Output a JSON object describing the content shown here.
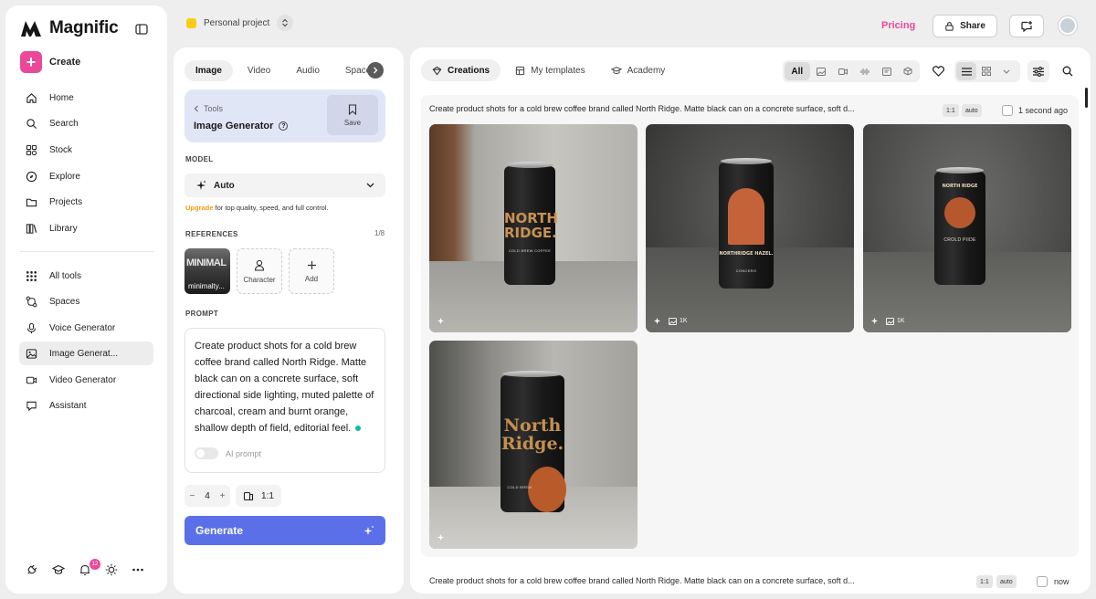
{
  "app": {
    "name": "Magnific"
  },
  "sidebar": {
    "create_label": "Create",
    "items": [
      {
        "label": "Home",
        "icon": "home-icon"
      },
      {
        "label": "Search",
        "icon": "search-icon"
      },
      {
        "label": "Stock",
        "icon": "stock-icon"
      },
      {
        "label": "Explore",
        "icon": "compass-icon"
      },
      {
        "label": "Projects",
        "icon": "folder-icon"
      },
      {
        "label": "Library",
        "icon": "library-icon"
      }
    ],
    "tools": [
      {
        "label": "All tools",
        "icon": "grid-icon"
      },
      {
        "label": "Spaces",
        "icon": "spaces-icon"
      },
      {
        "label": "Voice Generator",
        "icon": "mic-icon"
      },
      {
        "label": "Image Generat...",
        "icon": "image-icon",
        "active": true
      },
      {
        "label": "Video Generator",
        "icon": "video-icon"
      },
      {
        "label": "Assistant",
        "icon": "chat-icon"
      }
    ],
    "notification_count": "12"
  },
  "topbar": {
    "project_name": "Personal project",
    "project_color": "#facc15",
    "pricing_label": "Pricing",
    "share_label": "Share"
  },
  "tool_panel": {
    "tabs": [
      "Image",
      "Video",
      "Audio",
      "Spaces"
    ],
    "active_tab": "Image",
    "breadcrumb": "Tools",
    "tool_name": "Image Generator",
    "save_label": "Save",
    "model_label": "MODEL",
    "model_value": "Auto",
    "upgrade_link": "Upgrade",
    "upgrade_text": " for top quality, speed, and full control.",
    "references_label": "REFERENCES",
    "references_count": "1/8",
    "reference_image_text": "MINIMAL",
    "reference_image_name": "minimalty...",
    "character_label": "Character",
    "add_label": "Add",
    "prompt_label": "PROMPT",
    "prompt_text": "Create product shots for a cold brew coffee brand called North Ridge. Matte black can on a concrete surface, soft directional side lighting, muted palette of charcoal, cream and burnt orange, shallow depth of field, editorial feel.",
    "ai_prompt_label": "AI prompt",
    "count_value": "4",
    "minus_label": "−",
    "plus_label": "+",
    "aspect_ratio": "1:1",
    "generate_label": "Generate",
    "accent_color": "#5b70e8"
  },
  "main": {
    "tabs": [
      {
        "label": "Creations",
        "icon": "creations-icon"
      },
      {
        "label": "My templates",
        "icon": "templates-icon"
      },
      {
        "label": "Academy",
        "icon": "academy-icon"
      }
    ],
    "active_tab": "Creations",
    "filter_all": "All",
    "generations": [
      {
        "prompt": "Create product shots for a cold brew coffee brand called North Ridge. Matte black can on a concrete surface, soft d...",
        "ratio": "1:1",
        "mode": "auto",
        "time": "1 second ago",
        "images": [
          {
            "brand": "NORTH RIDGE.",
            "sub": "COLD BREW COFFEE",
            "res": ""
          },
          {
            "brand": "NORTHRIDGE HAZEL.",
            "sub": "CONCERO",
            "res": "1K"
          },
          {
            "brand": "NORTH RIDGE",
            "sub": "CROLD PIIDE",
            "res": "1K"
          },
          {
            "brand": "North Ridge.",
            "sub": "COLD BREW",
            "res": ""
          }
        ]
      },
      {
        "prompt": "Create product shots for a cold brew coffee brand called North Ridge. Matte black can on a concrete surface, soft d...",
        "ratio": "1:1",
        "mode": "auto",
        "time": "now"
      }
    ]
  }
}
